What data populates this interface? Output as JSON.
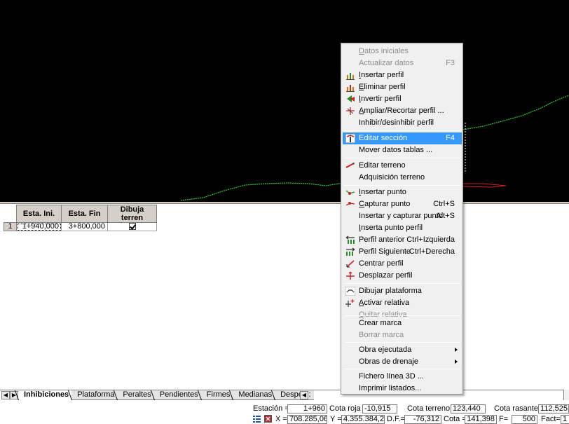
{
  "table": {
    "headers": [
      "Esta. Ini.",
      "Esta. Fin",
      "Dibuja terren"
    ],
    "rows": [
      {
        "num": "1",
        "ini": "1+940,000",
        "fin": "3+800,000",
        "checked": true
      }
    ]
  },
  "tabs": {
    "items": [
      "Inhibiciones",
      "Plataforma",
      "Peraltes",
      "Pendientes",
      "Firmes",
      "Medianas",
      "Despeje:"
    ],
    "active": "Inhibiciones"
  },
  "status": {
    "estacion_label": "Estación =",
    "estacion_value": "1+960",
    "cota_roja_label": "Cota roja =",
    "cota_roja_value": "-10,915",
    "cota_terreno_label": "Cota terreno =",
    "cota_terreno_value": "123,440",
    "cota_rasante_label": "Cota rasante =",
    "cota_rasante_value": "112,525",
    "x_label": "X =",
    "x_value": "708.285,060",
    "y_label": "Y =",
    "y_value": "4.355.384,234",
    "df_label": "D.F.=",
    "df_value": "-76,312",
    "cota_label": "Cota =",
    "cota_value": "141,398",
    "f_label": "F=",
    "f_value": "500",
    "fact_label": "Fact=",
    "fact_value": "1"
  },
  "menu": {
    "items": [
      {
        "label": "Datos iniciales",
        "ul": "D",
        "rest": "atos iniciales",
        "shortcut": "",
        "disabled": true,
        "icon": ""
      },
      {
        "label": "Actualizar datos",
        "shortcut": "F3",
        "disabled": true,
        "icon": ""
      },
      {
        "label": "Insertar perfil",
        "ul": "I",
        "rest": "nsertar perfil",
        "shortcut": "",
        "icon": "insert-profile-icon"
      },
      {
        "label": "Eliminar perfil",
        "ul": "E",
        "rest": "liminar perfil",
        "shortcut": "",
        "icon": "delete-profile-icon"
      },
      {
        "label": "Invertir perfil",
        "ul": "I",
        "rest": "nvertir perfil",
        "shortcut": "",
        "icon": "invert-profile-icon"
      },
      {
        "label": "Ampliar/Recortar perfil ...",
        "ul": "A",
        "rest": "mpliar/Recortar perfil ...",
        "shortcut": "",
        "icon": "trim-profile-icon"
      },
      {
        "label": "Inhibir/desinhibir perfil",
        "shortcut": "",
        "icon": ""
      },
      {
        "label": "Editar sección",
        "shortcut": "F4",
        "highlighted": true,
        "icon": "edit-section-icon"
      },
      {
        "label": "Mover datos tablas ...",
        "shortcut": "",
        "icon": ""
      },
      {
        "label": "Editar terreno",
        "shortcut": "",
        "icon": "edit-terrain-icon"
      },
      {
        "label": "Adquisición terreno",
        "shortcut": "",
        "icon": ""
      },
      {
        "label": "Insertar punto",
        "ul": "I",
        "rest": "nsertar punto",
        "shortcut": "",
        "icon": "insert-point-icon"
      },
      {
        "label": "Capturar punto",
        "ul": "C",
        "rest": "apturar punto",
        "shortcut": "Ctrl+S",
        "icon": "capture-point-icon"
      },
      {
        "label": "Insertar y capturar punto",
        "shortcut": "Alt+S",
        "icon": ""
      },
      {
        "label": "Inserta punto perfil",
        "ul": "I",
        "rest": "nserta punto perfil",
        "shortcut": "",
        "icon": ""
      },
      {
        "label": "Perfil anterior",
        "shortcut": "Ctrl+Izquierda",
        "icon": "previous-profile-icon"
      },
      {
        "label": "Perfil Siguiente",
        "shortcut": "Ctrl+Derecha",
        "icon": "next-profile-icon"
      },
      {
        "label": "Centrar perfil",
        "shortcut": "",
        "icon": "center-profile-icon"
      },
      {
        "label": "Desplazar perfil",
        "shortcut": "",
        "icon": "move-profile-icon"
      },
      {
        "label": "Dibujar plataforma",
        "shortcut": "",
        "icon": "draw-platform-icon"
      },
      {
        "label": "Activar relativa",
        "ul": "A",
        "rest": "ctivar relativa",
        "shortcut": "",
        "icon": "activate-relative-icon"
      },
      {
        "label": "Quitar relativa",
        "ul": "Q",
        "rest": "uitar relativa",
        "shortcut": "",
        "disabled": true,
        "icon": ""
      },
      {
        "label": "Crear marca",
        "shortcut": "",
        "icon": ""
      },
      {
        "label": "Borrar marca",
        "shortcut": "",
        "disabled": true,
        "icon": ""
      },
      {
        "label": "Obra ejecutada",
        "shortcut": "",
        "submenu": true,
        "icon": ""
      },
      {
        "label": "Obras de drenaje",
        "shortcut": "",
        "submenu": true,
        "icon": ""
      },
      {
        "label": "Fichero línea 3D ...",
        "shortcut": "",
        "icon": ""
      },
      {
        "label": "Imprimir listados...",
        "shortcut": "",
        "icon": ""
      }
    ]
  },
  "colors": {
    "canvas_bg": "#000000",
    "terrain_line": "#33cc33",
    "section_line": "#cc2222",
    "menu_highlight": "#3399ff"
  }
}
